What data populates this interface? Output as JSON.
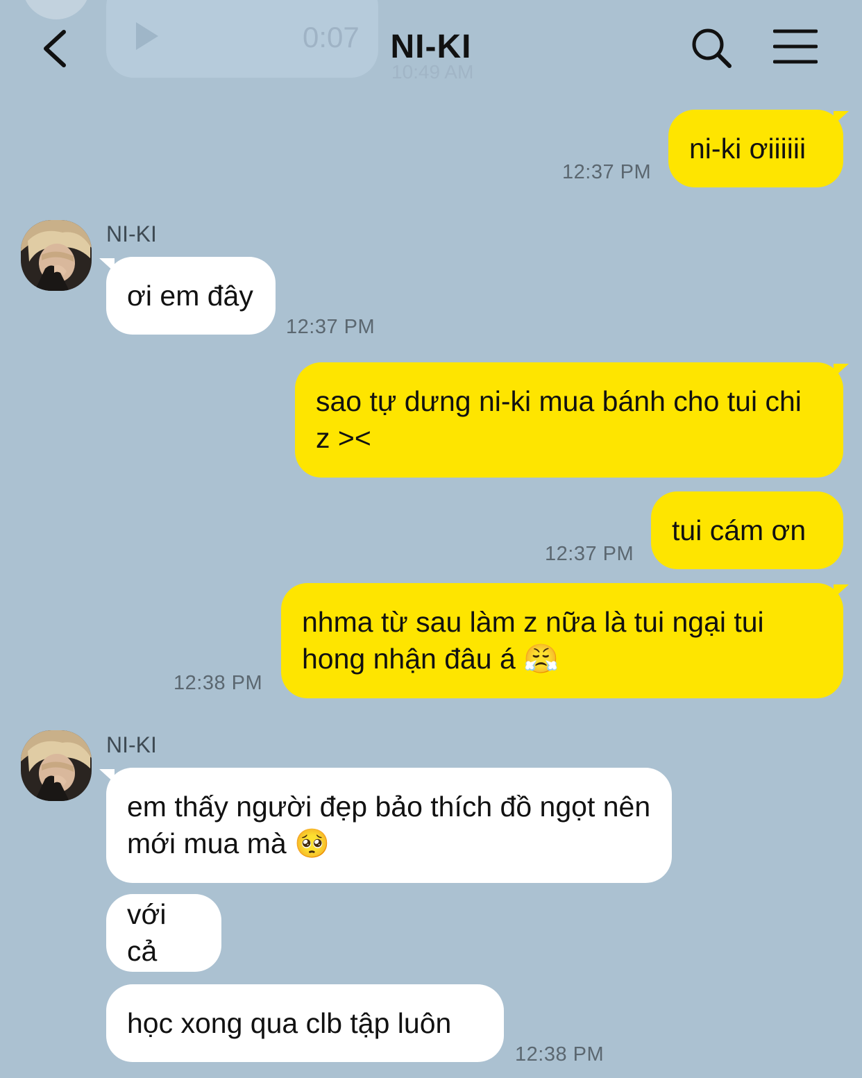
{
  "header": {
    "title": "NI-KI",
    "back_icon": "chevron-left-icon",
    "search_icon": "search-icon",
    "menu_icon": "hamburger-menu-icon"
  },
  "ghost_message": {
    "duration": "0:07",
    "time": "10:49 AM"
  },
  "messages": [
    {
      "from": "me",
      "text": "ni-ki ơiiiiii",
      "time": "12:37 PM"
    },
    {
      "from": "them",
      "sender": "NI-KI",
      "text": "ơi em đây",
      "time": "12:37 PM"
    },
    {
      "from": "me",
      "text": "sao tự dưng ni-ki mua bánh cho tui chi z ><",
      "time": ""
    },
    {
      "from": "me",
      "text": "tui cám ơn",
      "time": "12:37 PM"
    },
    {
      "from": "me",
      "text": "nhma từ sau làm z nữa là tui ngại tui hong nhận đâu á 😤",
      "time": "12:38 PM"
    },
    {
      "from": "them",
      "sender": "NI-KI",
      "text": "em thấy người đẹp bảo thích đồ ngọt nên mới mua mà 🥺",
      "time": ""
    },
    {
      "from": "them",
      "text": "với cả",
      "time": ""
    },
    {
      "from": "them",
      "text": "học xong qua clb tập luôn",
      "time": "12:38 PM"
    }
  ],
  "colors": {
    "background": "#abc1d1",
    "my_bubble": "#fee500",
    "their_bubble": "#ffffff"
  }
}
